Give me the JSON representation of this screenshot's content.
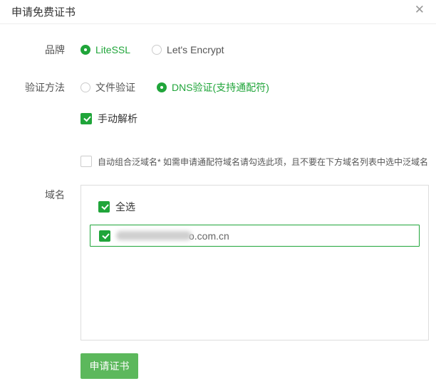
{
  "dialog": {
    "title": "申请免费证书",
    "close_icon": "✕"
  },
  "form": {
    "brand": {
      "label": "品牌",
      "options": [
        {
          "label": "LiteSSL",
          "selected": true
        },
        {
          "label": "Let's Encrypt",
          "selected": false
        }
      ]
    },
    "verify_method": {
      "label": "验证方法",
      "options": [
        {
          "label": "文件验证",
          "selected": false
        },
        {
          "label": "DNS验证(支持通配符)",
          "selected": true
        }
      ]
    },
    "manual_resolve": {
      "label": "手动解析",
      "checked": true
    },
    "auto_wildcard": {
      "label": "自动组合泛域名* 如需申请通配符域名请勾选此项，且不要在下方域名列表中选中泛域名",
      "checked": false
    },
    "domains": {
      "label": "域名",
      "select_all": {
        "label": "全选",
        "checked": true
      },
      "items": [
        {
          "suffix": "o.com.cn",
          "masked": true,
          "checked": true,
          "selected": true
        }
      ]
    },
    "submit": {
      "label": "申请证书"
    }
  },
  "colors": {
    "accent_green": "#20a53a",
    "button_green": "#5cb85c"
  }
}
